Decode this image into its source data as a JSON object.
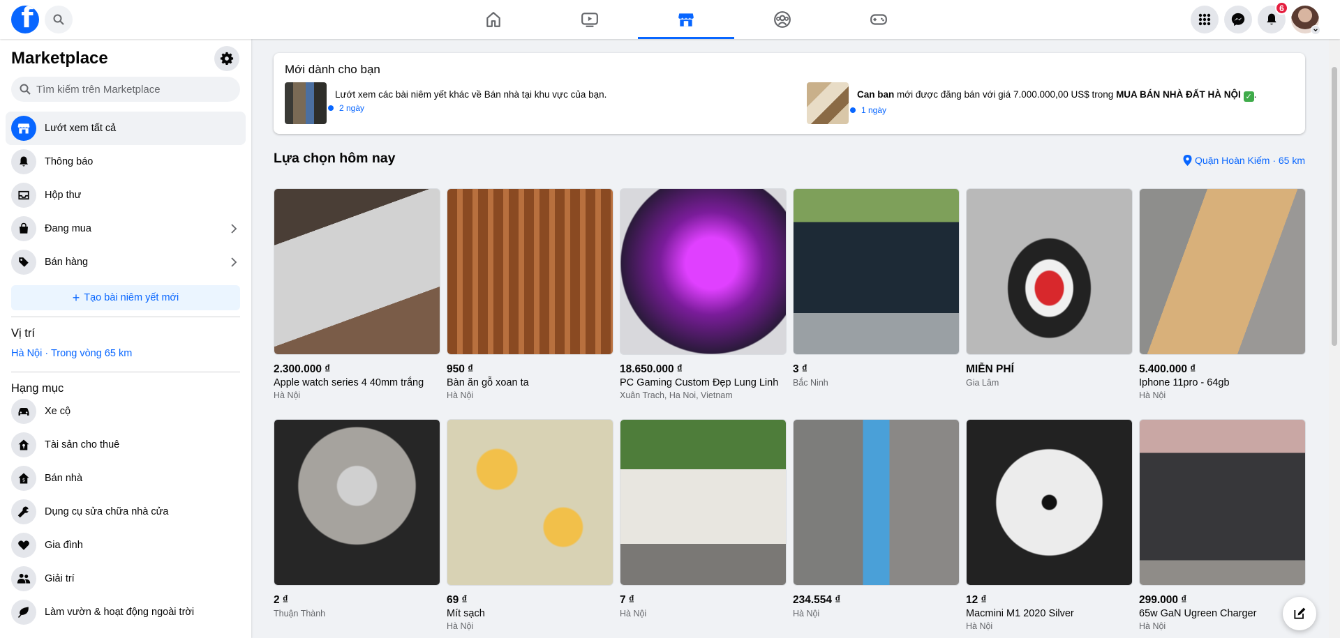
{
  "topbar": {
    "logo_letter": "f",
    "notification_count": "6"
  },
  "sidebar": {
    "title": "Marketplace",
    "search_placeholder": "Tìm kiếm trên Marketplace",
    "menu": [
      {
        "label": "Lướt xem tất cả",
        "icon": "storefront-icon"
      },
      {
        "label": "Thông báo",
        "icon": "bell-icon"
      },
      {
        "label": "Hộp thư",
        "icon": "inbox-icon"
      },
      {
        "label": "Đang mua",
        "icon": "shopping-bag-icon"
      },
      {
        "label": "Bán hàng",
        "icon": "tag-icon"
      }
    ],
    "create_label": "Tạo bài niêm yết mới",
    "location_heading": "Vị trí",
    "location_value": "Hà Nội · Trong vòng 65 km",
    "categories_heading": "Hạng mục",
    "categories": [
      {
        "label": "Xe cộ",
        "icon": "car-icon"
      },
      {
        "label": "Tài sản cho thuê",
        "icon": "house-key-icon"
      },
      {
        "label": "Bán nhà",
        "icon": "house-tag-icon"
      },
      {
        "label": "Dụng cụ sửa chữa nhà cửa",
        "icon": "wrench-icon"
      },
      {
        "label": "Gia đình",
        "icon": "heart-icon"
      },
      {
        "label": "Giải trí",
        "icon": "people-icon"
      },
      {
        "label": "Làm vườn & hoạt động ngoài trời",
        "icon": "leaf-icon"
      }
    ]
  },
  "new_for_you": {
    "title": "Mới dành cho bạn",
    "notifications": [
      {
        "text_plain": "Lướt xem các bài niêm yết khác về Bán nhà tại khu vực của bạn.",
        "time": "2 ngày"
      },
      {
        "text_bold_start": "Can ban",
        "text_middle": " mới được đăng bán với giá 7.000.000,00 US$ trong ",
        "text_bold_end": "MUA BÁN NHÀ ĐẤT HÀ NỘI",
        "text_end": ".",
        "time": "1 ngày"
      }
    ]
  },
  "today": {
    "heading": "Lựa chọn hôm nay",
    "location_link": "Quận Hoàn Kiếm · 65 km"
  },
  "listings": [
    {
      "price": "2.300.000 ₫",
      "title": "Apple watch series 4 40mm trắng",
      "location": "Hà Nội"
    },
    {
      "price": "950 ₫",
      "title": "Bàn ăn gỗ xoan ta",
      "location": "Hà Nội"
    },
    {
      "price": "18.650.000 ₫",
      "title": "PC Gaming Custom Đẹp Lung Linh",
      "location": "Xuân Trach, Ha Noi, Vietnam"
    },
    {
      "price": "3 ₫",
      "title": "",
      "location": "Bắc Ninh"
    },
    {
      "price": "MIỄN PHÍ",
      "title": "",
      "location": "Gia Lâm"
    },
    {
      "price": "5.400.000 ₫",
      "title": "Iphone 11pro - 64gb",
      "location": "Hà Nội"
    },
    {
      "price": "2 ₫",
      "title": "",
      "location": "Thuận Thành"
    },
    {
      "price": "69 ₫",
      "title": "Mít sạch",
      "location": "Hà Nội"
    },
    {
      "price": "7 ₫",
      "title": "",
      "location": "Hà Nội"
    },
    {
      "price": "234.554 ₫",
      "title": "",
      "location": "Hà Nội"
    },
    {
      "price": "12 ₫",
      "title": "Macmini M1 2020 Silver",
      "location": "Hà Nội"
    },
    {
      "price": "299.000 ₫",
      "title": "65w GaN Ugreen Charger",
      "location": "Hà Nội"
    }
  ],
  "colors": {
    "accent": "#0866ff",
    "background": "#f0f2f5",
    "badge": "#e41e3f"
  }
}
